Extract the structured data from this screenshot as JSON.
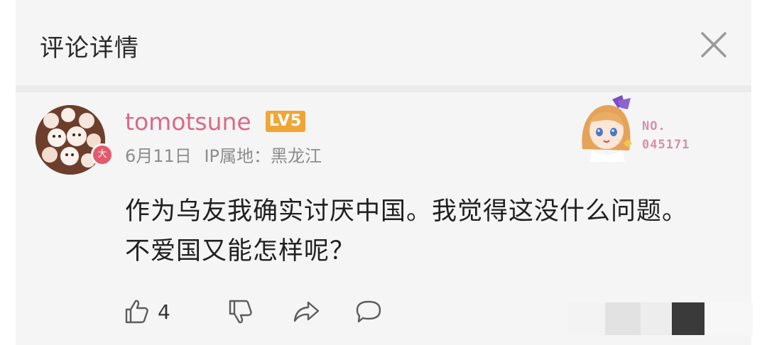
{
  "header": {
    "title": "评论详情",
    "close_icon": "close-icon"
  },
  "comment": {
    "author": {
      "username": "tomotsune",
      "level_badge": "LV5",
      "avatar_badge": "大",
      "avatar_icon": "avatar-image"
    },
    "date": "6月11日",
    "ip_location": "IP属地：黑龙江",
    "medal": {
      "label_line1": "NO.",
      "label_line2": "045171",
      "icon": "anime-girl-medal-icon"
    },
    "text": "作为乌友我确实讨厌中国。我觉得这没什么问题。不爱国又能怎样呢？",
    "actions": {
      "like_count": "4",
      "like_icon": "thumbs-up-icon",
      "dislike_icon": "thumbs-down-icon",
      "share_icon": "share-icon",
      "reply_icon": "comment-icon"
    }
  },
  "colors": {
    "username": "#d96a87",
    "level_badge": "#f0a636",
    "medal_text": "#d58fa9",
    "background": "#f5f5f5"
  }
}
